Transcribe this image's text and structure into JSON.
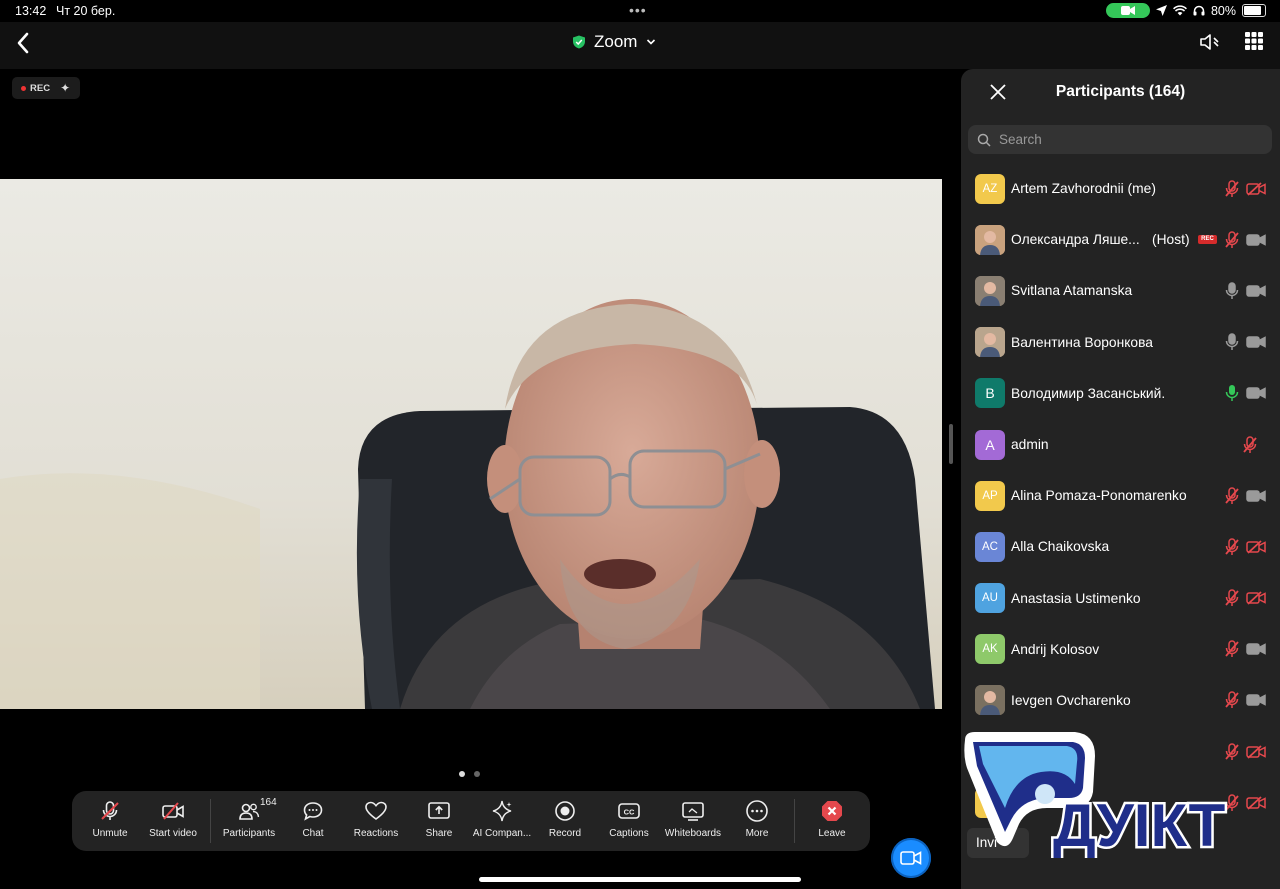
{
  "status": {
    "time": "13:42",
    "date": "Чт 20 бер.",
    "battery": "80%",
    "battery_level": 0.8
  },
  "header": {
    "title": "Zoom"
  },
  "recording": {
    "label": "REC"
  },
  "video": {
    "page_count": 2,
    "active_page": 1
  },
  "toolbar": {
    "unmute": "Unmute",
    "start_video": "Start video",
    "participants": "Participants",
    "participants_count": "164",
    "chat": "Chat",
    "reactions": "Reactions",
    "share": "Share",
    "ai_companion": "AI Compan...",
    "record": "Record",
    "captions": "Captions",
    "captions_icon_text": "CC",
    "whiteboards": "Whiteboards",
    "more": "More",
    "leave": "Leave"
  },
  "panel": {
    "title": "Participants (164)",
    "search_placeholder": "Search",
    "invite": "Invi",
    "participants": [
      {
        "initials": "AZ",
        "name": "Artem Zavhorodnii (me)",
        "avatar_color": "#f2c94c",
        "mic": "muted",
        "camera": "off"
      },
      {
        "initials": "",
        "name": "Олександра Ляше...",
        "role": "(Host)",
        "rec": "REC",
        "avatar_color": "#c9a27e",
        "photo": true,
        "mic": "muted",
        "camera": "on"
      },
      {
        "initials": "",
        "name": "Svitlana Atamanska",
        "avatar_color": "#8a7f72",
        "photo": true,
        "mic": "on",
        "camera": "on"
      },
      {
        "initials": "",
        "name": "Валентина Воронкова",
        "avatar_color": "#b9a58d",
        "photo": true,
        "mic": "on",
        "camera": "on"
      },
      {
        "initials": "B",
        "name": "Володимир Засанський.",
        "avatar_color": "#0f7a6a",
        "mic": "speaking",
        "camera": "on"
      },
      {
        "initials": "A",
        "name": "admin",
        "avatar_color": "#a36ad6",
        "mic": "muted",
        "camera": "none"
      },
      {
        "initials": "AP",
        "name": "Alina Pomaza-Ponomarenko",
        "avatar_color": "#f2c94c",
        "mic": "muted",
        "camera": "on"
      },
      {
        "initials": "AC",
        "name": "Alla Chaikovska",
        "avatar_color": "#6a86d6",
        "mic": "muted",
        "camera": "off"
      },
      {
        "initials": "AU",
        "name": "Anastasia Ustimenko",
        "avatar_color": "#4fa3e0",
        "mic": "muted",
        "camera": "off"
      },
      {
        "initials": "AK",
        "name": "Andrij Kolosov",
        "avatar_color": "#8ec96a",
        "mic": "muted",
        "camera": "on"
      },
      {
        "initials": "",
        "name": "Ievgen Ovcharenko",
        "avatar_color": "#7a7060",
        "photo": true,
        "mic": "muted",
        "camera": "on"
      },
      {
        "initials": "",
        "name": "",
        "avatar_color": "#232323",
        "mic": "muted",
        "camera": "off"
      },
      {
        "initials": "",
        "name": "",
        "avatar_color": "#f2c94c",
        "mic": "muted",
        "camera": "off"
      }
    ]
  },
  "watermark": {
    "text": "ДУІКТ"
  },
  "colors": {
    "accent": "#1a8cff",
    "muted_red": "#e5484d",
    "speaking_green": "#34c759",
    "panel_bg": "#232323"
  }
}
